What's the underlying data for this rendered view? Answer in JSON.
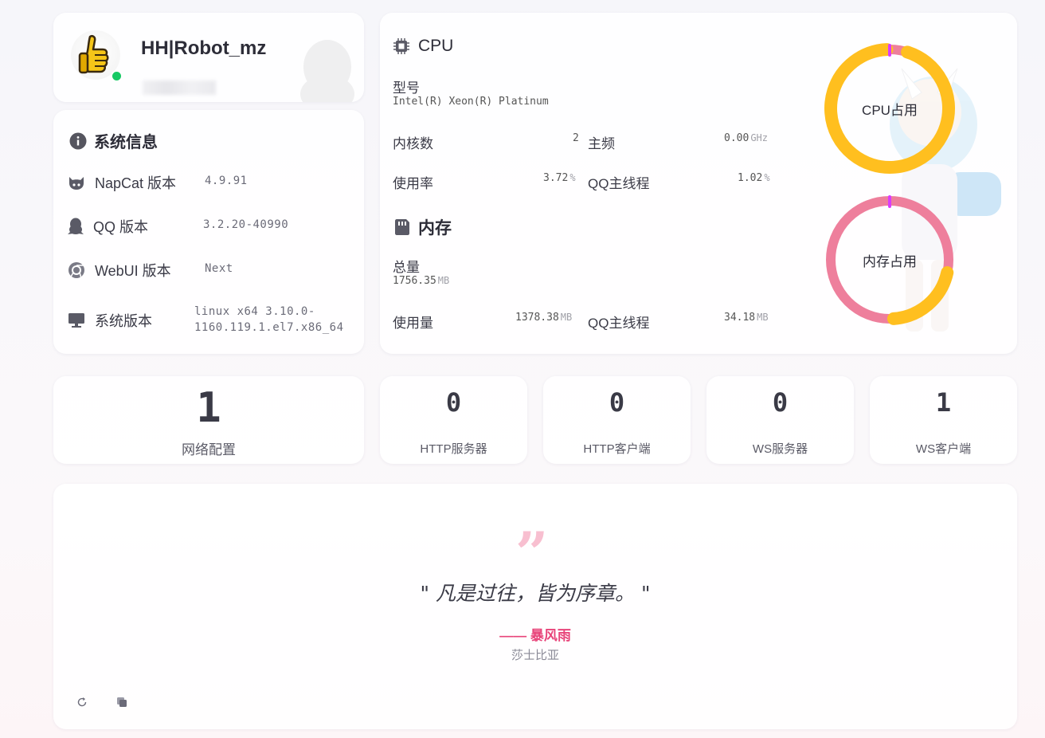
{
  "profile": {
    "nickname": "HH|Robot_mz",
    "status": "online",
    "avatar": "thumbs-up-icon"
  },
  "system_info": {
    "title": "系统信息",
    "rows": [
      {
        "label": "NapCat 版本",
        "value": "4.9.91",
        "icon": "github-cat-icon"
      },
      {
        "label": "QQ 版本",
        "value": "3.2.20-40990",
        "icon": "qq-penguin-icon"
      },
      {
        "label": "WebUI 版本",
        "value": "Next",
        "icon": "chrome-icon"
      },
      {
        "label": "系统版本",
        "value": "linux x64 3.10.0-1160.119.1.el7.x86_64",
        "value_line1": "linux x64 3.10.0-",
        "value_line2": "1160.119.1.el7.x86_64",
        "icon": "monitor-icon"
      }
    ]
  },
  "cpu": {
    "title": "CPU",
    "model_label": "型号",
    "model_value": "Intel(R) Xeon(R) Platinum",
    "cores_label": "内核数",
    "cores_value": "2",
    "freq_label": "主频",
    "freq_value": "0.00",
    "freq_unit": "GHz",
    "usage_label": "使用率",
    "usage_value": "3.72",
    "usage_unit": "%",
    "qq_label": "QQ主线程",
    "qq_value": "1.02",
    "qq_unit": "%",
    "ring_label": "CPU占用"
  },
  "memory": {
    "title": "内存",
    "total_label": "总量",
    "total_value": "1756.35",
    "total_unit": "MB",
    "used_label": "使用量",
    "used_value": "1378.38",
    "used_unit": "MB",
    "qq_label": "QQ主线程",
    "qq_value": "34.18",
    "qq_unit": "MB",
    "ring_label": "内存占用"
  },
  "stats": {
    "network": {
      "value": "1",
      "label": "网络配置"
    },
    "http_server": {
      "value": "0",
      "label": "HTTP服务器"
    },
    "http_client": {
      "value": "0",
      "label": "HTTP客户端"
    },
    "ws_server": {
      "value": "0",
      "label": "WS服务器"
    },
    "ws_client": {
      "value": "1",
      "label": "WS客户端"
    }
  },
  "quote": {
    "mark": "”",
    "text": "\" 凡是过往，皆为序章。 \"",
    "author": "—— 暴风雨",
    "source": "莎士比亚"
  },
  "colors": {
    "accent": "#e8447a",
    "ring_cpu": "#ffbf1f",
    "ring_mem": "#ee7f9c",
    "online": "#17c964"
  }
}
